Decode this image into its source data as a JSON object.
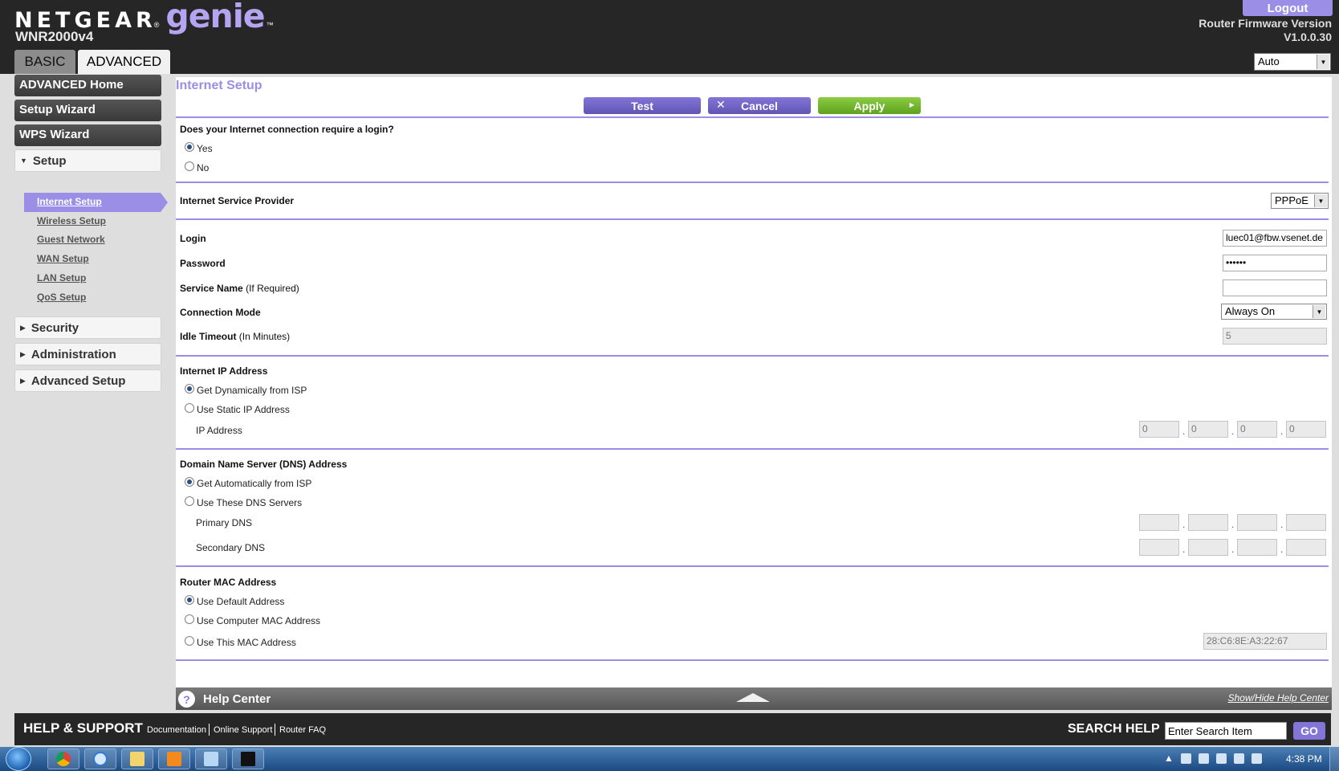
{
  "header": {
    "brand": "NETGEAR",
    "brand_reg": "®",
    "product": "genie",
    "product_tm": "™",
    "model": "WNR2000v4",
    "logout_label": "Logout",
    "firmware_label": "Router Firmware Version",
    "firmware_version": "V1.0.0.30",
    "language": "Auto",
    "tabs": [
      {
        "label": "BASIC",
        "selected": false
      },
      {
        "label": "ADVANCED",
        "selected": true
      }
    ]
  },
  "sidebar": {
    "primary": [
      "ADVANCED Home",
      "Setup Wizard",
      "WPS Wizard"
    ],
    "setup_label": "Setup",
    "setup_items": [
      {
        "label": "Internet Setup",
        "active": true
      },
      {
        "label": "Wireless Setup",
        "active": false
      },
      {
        "label": "Guest Network",
        "active": false
      },
      {
        "label": "WAN Setup",
        "active": false
      },
      {
        "label": "LAN Setup",
        "active": false
      },
      {
        "label": "QoS Setup",
        "active": false
      }
    ],
    "collapsed": [
      "Security",
      "Administration",
      "Advanced Setup"
    ]
  },
  "page": {
    "title": "Internet Setup",
    "buttons": {
      "test": "Test",
      "cancel": "Cancel",
      "apply": "Apply"
    },
    "login_required": {
      "question": "Does your Internet connection require a login?",
      "options": [
        {
          "label": "Yes",
          "selected": true
        },
        {
          "label": "No",
          "selected": false
        }
      ]
    },
    "isp": {
      "label": "Internet Service Provider",
      "value": "PPPoE"
    },
    "login": {
      "label": "Login",
      "value": "luec01@fbw.vsenet.de"
    },
    "password": {
      "label": "Password",
      "value": "••••••"
    },
    "service_name": {
      "label": "Service Name",
      "note": "(If Required)",
      "value": ""
    },
    "connection_mode": {
      "label": "Connection Mode",
      "value": "Always On"
    },
    "idle_timeout": {
      "label": "Idle Timeout",
      "note": "(In Minutes)",
      "value": "5"
    },
    "internet_ip": {
      "label": "Internet IP Address",
      "options": [
        {
          "label": "Get Dynamically from ISP",
          "selected": true
        },
        {
          "label": "Use Static IP Address",
          "selected": false
        }
      ],
      "ip_label": "IP Address",
      "ip": [
        "0",
        "0",
        "0",
        "0"
      ]
    },
    "dns": {
      "label": "Domain Name Server (DNS) Address",
      "options": [
        {
          "label": "Get Automatically from ISP",
          "selected": true
        },
        {
          "label": "Use These DNS Servers",
          "selected": false
        }
      ],
      "primary_label": "Primary DNS",
      "secondary_label": "Secondary DNS",
      "primary": [
        "",
        "",
        "",
        ""
      ],
      "secondary": [
        "",
        "",
        "",
        ""
      ]
    },
    "mac": {
      "label": "Router MAC Address",
      "options": [
        {
          "label": "Use Default Address",
          "selected": true
        },
        {
          "label": "Use Computer MAC Address",
          "selected": false
        },
        {
          "label": "Use This MAC Address",
          "selected": false
        }
      ],
      "value": "28:C6:8E:A3:22:67"
    }
  },
  "help_center": {
    "title": "Help Center",
    "toggle": "Show/Hide Help Center"
  },
  "footer": {
    "title": "HELP & SUPPORT",
    "links": [
      "Documentation",
      "Online Support",
      "Router FAQ"
    ],
    "search_label": "SEARCH HELP",
    "search_value": "Enter Search Item",
    "go": "GO"
  },
  "taskbar": {
    "clock": "4:38 PM"
  },
  "colors": {
    "accent": "#9a8ee6",
    "header_bg": "#262626",
    "apply_green": "#7bbf3a"
  }
}
